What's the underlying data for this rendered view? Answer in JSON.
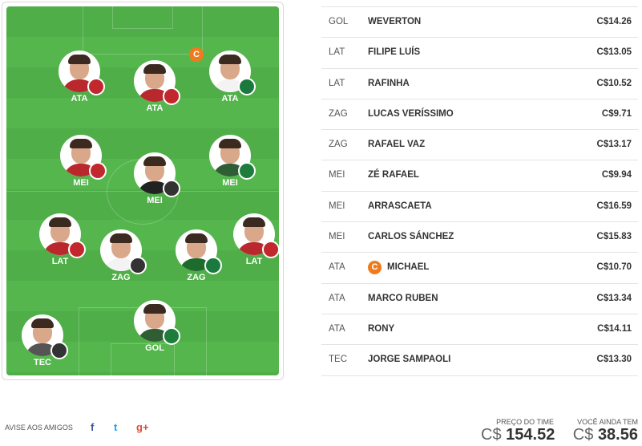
{
  "field": {
    "players": [
      {
        "pos": "ATA",
        "shirt": "#b8282d",
        "crest": "#c2272d"
      },
      {
        "pos": "ATA",
        "shirt": "#b8282d",
        "crest": "#c2272d"
      },
      {
        "pos": "ATA",
        "shirt": "#f3f3f3",
        "crest": "#1a7a3e",
        "captain": "C"
      },
      {
        "pos": "MEI",
        "shirt": "#b8282d",
        "crest": "#c2272d"
      },
      {
        "pos": "MEI",
        "shirt": "#222222",
        "crest": "#333333"
      },
      {
        "pos": "MEI",
        "shirt": "#2f5e35",
        "crest": "#1e7d3a"
      },
      {
        "pos": "LAT",
        "shirt": "#b8282d",
        "crest": "#c2272d"
      },
      {
        "pos": "ZAG",
        "shirt": "#f3f3f3",
        "crest": "#333333"
      },
      {
        "pos": "ZAG",
        "shirt": "#1e6b2e",
        "crest": "#1a7a3e"
      },
      {
        "pos": "LAT",
        "shirt": "#b8282d",
        "crest": "#c2272d"
      },
      {
        "pos": "GOL",
        "shirt": "#2f5e35",
        "crest": "#1e7d3a"
      },
      {
        "pos": "TEC",
        "shirt": "#555555",
        "crest": "#333333"
      }
    ]
  },
  "lineup": [
    {
      "pos": "GOL",
      "name": "WEVERTON",
      "price": "C$14.26"
    },
    {
      "pos": "LAT",
      "name": "FILIPE LUÍS",
      "price": "C$13.05"
    },
    {
      "pos": "LAT",
      "name": "RAFINHA",
      "price": "C$10.52"
    },
    {
      "pos": "ZAG",
      "name": "LUCAS VERÍSSIMO",
      "price": "C$9.71"
    },
    {
      "pos": "ZAG",
      "name": "RAFAEL VAZ",
      "price": "C$13.17"
    },
    {
      "pos": "MEI",
      "name": "ZÉ RAFAEL",
      "price": "C$9.94"
    },
    {
      "pos": "MEI",
      "name": "ARRASCAETA",
      "price": "C$16.59"
    },
    {
      "pos": "MEI",
      "name": "CARLOS SÁNCHEZ",
      "price": "C$15.83"
    },
    {
      "pos": "ATA",
      "name": "MICHAEL",
      "price": "C$10.70",
      "captain": "C"
    },
    {
      "pos": "ATA",
      "name": "MARCO RUBEN",
      "price": "C$13.34"
    },
    {
      "pos": "ATA",
      "name": "RONY",
      "price": "C$14.11"
    },
    {
      "pos": "TEC",
      "name": "JORGE SAMPAOLI",
      "price": "C$13.30"
    }
  ],
  "footer": {
    "share_label": "AVISE AOS AMIGOS",
    "social": [
      {
        "icon": "facebook-icon",
        "glyph": "f",
        "color": "#3b5998"
      },
      {
        "icon": "twitter-icon",
        "glyph": "t",
        "color": "#1da1f2"
      },
      {
        "icon": "google-plus-icon",
        "glyph": "g+",
        "color": "#dd4b39"
      }
    ],
    "team_price_label": "PREÇO DO TIME",
    "team_price_currency": "C$",
    "team_price_value": "154.52",
    "remaining_label": "VOCÊ AINDA TEM",
    "remaining_currency": "C$",
    "remaining_value": "38.56"
  },
  "colors": {
    "captain": "#f07b1d",
    "field_light": "#55b64d",
    "field_dark": "#4fae48"
  }
}
